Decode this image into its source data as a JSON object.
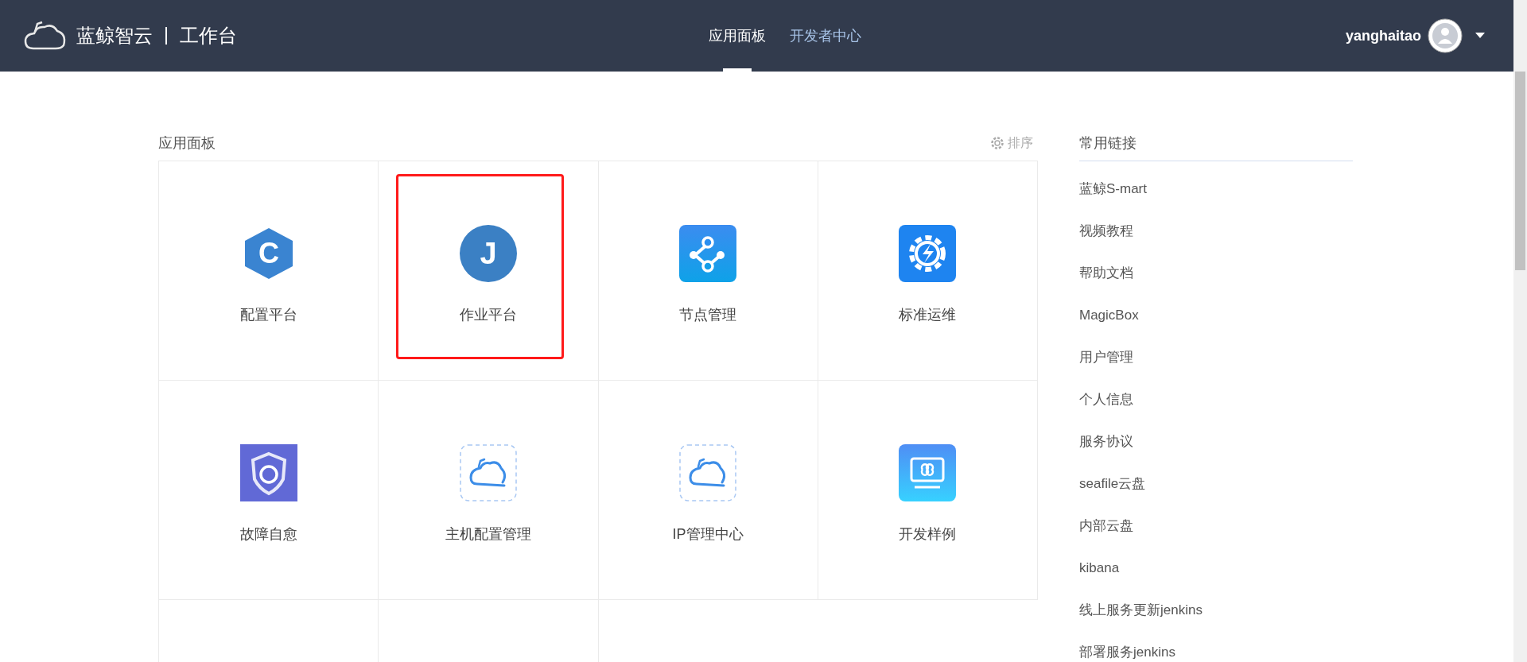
{
  "header": {
    "brand": "蓝鲸智云",
    "product": "工作台",
    "nav": [
      {
        "label": "应用面板",
        "selected": true
      },
      {
        "label": "开发者中心",
        "selected": false
      }
    ],
    "user": "yanghaitao"
  },
  "panel": {
    "title": "应用面板",
    "sort_label": "排序",
    "tiles": [
      {
        "kind": "hexagon",
        "glyph": "C",
        "label": "配置平台",
        "highlighted": false
      },
      {
        "kind": "circle",
        "glyph": "J",
        "label": "作业平台",
        "highlighted": true
      },
      {
        "kind": "nodes",
        "label": "节点管理",
        "highlighted": false
      },
      {
        "kind": "gear",
        "label": "标准运维",
        "highlighted": false
      },
      {
        "kind": "shield",
        "label": "故障自愈",
        "highlighted": false
      },
      {
        "kind": "cloud",
        "label": "主机配置管理",
        "highlighted": false
      },
      {
        "kind": "cloud",
        "label": "IP管理中心",
        "highlighted": false
      },
      {
        "kind": "monitor",
        "label": "开发样例",
        "highlighted": false
      },
      {
        "kind": "empty",
        "highlighted": false
      },
      {
        "kind": "empty",
        "highlighted": false
      }
    ]
  },
  "links": {
    "title": "常用链接",
    "items": [
      "蓝鲸S-mart",
      "视频教程",
      "帮助文档",
      "MagicBox",
      "用户管理",
      "个人信息",
      "服务协议",
      "seafile云盘",
      "内部云盘",
      "kibana",
      "线上服务更新jenkins",
      "部署服务jenkins"
    ]
  }
}
